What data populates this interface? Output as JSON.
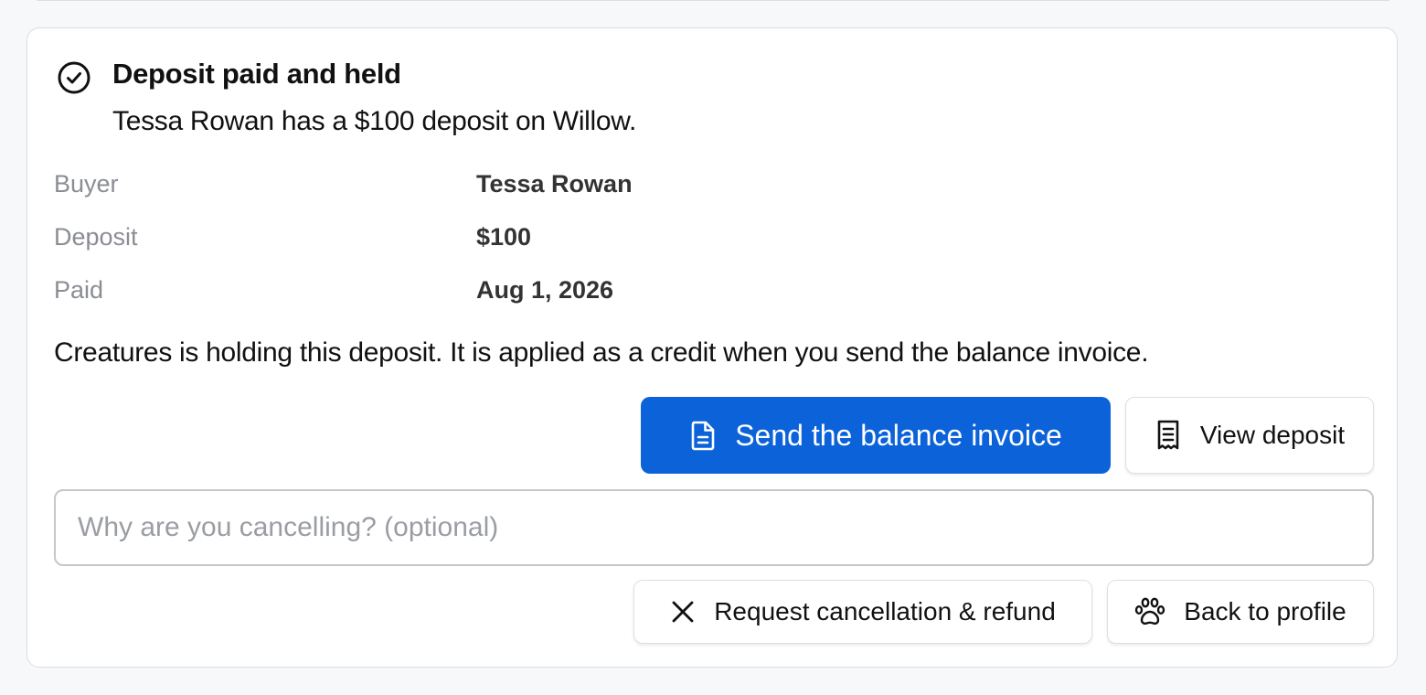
{
  "deposit_status": {
    "title": "Deposit paid and held",
    "subtitle": "Tessa Rowan has a $100 deposit on Willow.",
    "icon": "check-circle-icon"
  },
  "details": [
    {
      "label": "Buyer",
      "value": "Tessa Rowan"
    },
    {
      "label": "Deposit",
      "value": "$100"
    },
    {
      "label": "Paid",
      "value": "Aug 1, 2026"
    }
  ],
  "note": "Creatures is holding this deposit. It is applied as a credit when you send the balance invoice.",
  "actions": {
    "send_invoice_label": "Send the balance invoice",
    "send_invoice_icon": "document-icon",
    "view_deposit_label": "View deposit",
    "view_deposit_icon": "receipt-icon"
  },
  "cancellation": {
    "reason_placeholder": "Why are you cancelling? (optional)",
    "reason_value": "",
    "request_label": "Request cancellation & refund",
    "request_icon": "close-icon",
    "back_label": "Back to profile",
    "back_icon": "paw-icon"
  },
  "colors": {
    "primary": "#0b62d9",
    "label_gray": "#8a8d93",
    "border": "#dcdfe4",
    "background": "#f7f8fa"
  }
}
